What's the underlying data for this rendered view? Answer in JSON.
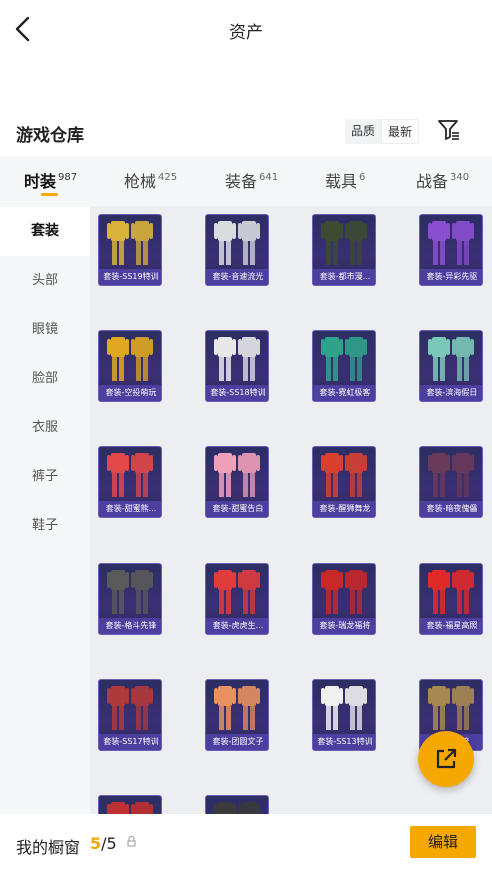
{
  "header": {
    "title": "资产"
  },
  "warehouse": {
    "title": "游戏仓库",
    "sort_options": [
      "品质",
      "最新"
    ],
    "active_sort": "最新"
  },
  "tabs": [
    {
      "label": "时装",
      "count": "987",
      "active": true
    },
    {
      "label": "枪械",
      "count": "425",
      "active": false
    },
    {
      "label": "装备",
      "count": "641",
      "active": false
    },
    {
      "label": "载具",
      "count": "6",
      "active": false
    },
    {
      "label": "战备",
      "count": "340",
      "active": false
    }
  ],
  "sidebar": {
    "items": [
      {
        "label": "套装",
        "active": true
      },
      {
        "label": "头部",
        "active": false
      },
      {
        "label": "眼镜",
        "active": false
      },
      {
        "label": "脸部",
        "active": false
      },
      {
        "label": "衣服",
        "active": false
      },
      {
        "label": "裤子",
        "active": false
      },
      {
        "label": "鞋子",
        "active": false
      }
    ]
  },
  "items": [
    {
      "label": "套装-SS19特训",
      "color": "#d8b23a"
    },
    {
      "label": "套装-音速流光",
      "color": "#d8dcdf"
    },
    {
      "label": "套装-都市漫...",
      "color": "#3c4b32"
    },
    {
      "label": "套装-异彩先驱",
      "color": "#8a4fd0"
    },
    {
      "label": "套装-空投萌玩",
      "color": "#e0a820"
    },
    {
      "label": "套装-SS18特训",
      "color": "#e8e8e8"
    },
    {
      "label": "套装-霓虹极客",
      "color": "#2fa38a"
    },
    {
      "label": "套装-滨海假日",
      "color": "#7cc8b8"
    },
    {
      "label": "套装-甜蜜熊...",
      "color": "#e24848"
    },
    {
      "label": "套装-甜蜜告白",
      "color": "#f0a0b8"
    },
    {
      "label": "套装-醒狮舞龙",
      "color": "#d94030"
    },
    {
      "label": "套装-暗夜傀儡",
      "color": "#6a3a5a"
    },
    {
      "label": "套装-格斗先锋",
      "color": "#5a5a5a"
    },
    {
      "label": "套装-虎虎生...",
      "color": "#e03c3c"
    },
    {
      "label": "套装-瑞龙福将",
      "color": "#c82828"
    },
    {
      "label": "套装-福星高照",
      "color": "#e02a2a"
    },
    {
      "label": "套装-SS17特训",
      "color": "#b03a3a"
    },
    {
      "label": "套装-团圆文子",
      "color": "#e89060"
    },
    {
      "label": "套装-SS13特训",
      "color": "#f0f0f0"
    },
    {
      "label": "套装-...流",
      "color": "#a88850"
    },
    {
      "label": "",
      "color": "#c03030"
    },
    {
      "label": "",
      "color": "#3a3a3a"
    }
  ],
  "showcase": {
    "label": "我的橱窗",
    "current": "5",
    "separator": "/",
    "total": "5",
    "edit_label": "编辑"
  },
  "colors": {
    "accent": "#f5a800",
    "card_bg": "#2c2e63",
    "card_label_bg": "#4c3fa0"
  }
}
